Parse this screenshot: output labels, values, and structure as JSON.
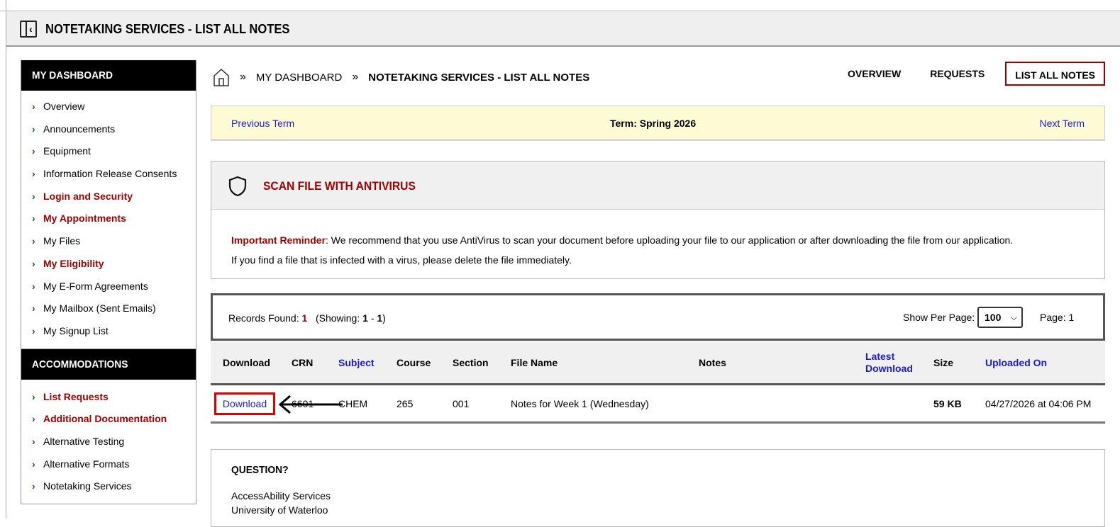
{
  "header": {
    "title": "NOTETAKING SERVICES - LIST ALL NOTES"
  },
  "sidebar": {
    "dashboard_title": "MY DASHBOARD",
    "dashboard_items": [
      {
        "label": "Overview",
        "highlight": false
      },
      {
        "label": "Announcements",
        "highlight": false
      },
      {
        "label": "Equipment",
        "highlight": false
      },
      {
        "label": "Information Release Consents",
        "highlight": false
      },
      {
        "label": "Login and Security",
        "highlight": true
      },
      {
        "label": "My Appointments",
        "highlight": true
      },
      {
        "label": "My Files",
        "highlight": false
      },
      {
        "label": "My Eligibility",
        "highlight": true
      },
      {
        "label": "My E-Form Agreements",
        "highlight": false
      },
      {
        "label": "My Mailbox (Sent Emails)",
        "highlight": false
      },
      {
        "label": "My Signup List",
        "highlight": false
      }
    ],
    "accommodations_title": "ACCOMMODATIONS",
    "accommodation_items": [
      {
        "label": "List Requests",
        "highlight": true
      },
      {
        "label": "Additional Documentation",
        "highlight": true
      },
      {
        "label": "Alternative Testing",
        "highlight": false
      },
      {
        "label": "Alternative Formats",
        "highlight": false
      },
      {
        "label": "Notetaking Services",
        "highlight": false
      }
    ]
  },
  "breadcrumb": {
    "sep": "»",
    "item1": "MY DASHBOARD",
    "item2": "NOTETAKING SERVICES - LIST ALL NOTES"
  },
  "tabs": {
    "overview": "OVERVIEW",
    "requests": "REQUESTS",
    "list_all": "LIST ALL NOTES"
  },
  "term": {
    "prev": "Previous Term",
    "current": "Term: Spring 2026",
    "next": "Next Term"
  },
  "scan": {
    "title": "SCAN FILE WITH ANTIVIRUS",
    "reminder_label": "Important Reminder",
    "reminder_text": ": We recommend that you use AntiVirus to scan your document before uploading your file to our application or after downloading the file from our application.",
    "line2": "If you find a file that is infected with a virus, please delete the file immediately."
  },
  "records": {
    "found_label": "Records Found:",
    "found_count": "1",
    "showing_label": "(Showing:",
    "showing_from": "1",
    "showing_dash": "-",
    "showing_to": "1",
    "showing_close": ")",
    "per_page_label": "Show Per Page:",
    "per_page_value": "100",
    "page_label": "Page: 1"
  },
  "table": {
    "headers": {
      "download": "Download",
      "crn": "CRN",
      "subject": "Subject",
      "course": "Course",
      "section": "Section",
      "file_name": "File Name",
      "notes": "Notes",
      "latest_download_1": "Latest",
      "latest_download_2": "Download",
      "size": "Size",
      "uploaded_on": "Uploaded On"
    },
    "row": {
      "download": "Download",
      "crn": "6601",
      "subject": "CHEM",
      "course": "265",
      "section": "001",
      "file_name": "Notes for Week 1 (Wednesday)",
      "notes": "",
      "latest_download": "",
      "size": "59 KB",
      "uploaded_on": "04/27/2026 at 04:06 PM"
    }
  },
  "question": {
    "title": "QUESTION?",
    "line1": "AccessAbility Services",
    "line2": "University of Waterloo"
  },
  "colors": {
    "accent_red": "#a00000",
    "link_blue": "#1a1ae0",
    "highlight_box": "#e00000",
    "term_bg": "#fdfbd4"
  }
}
